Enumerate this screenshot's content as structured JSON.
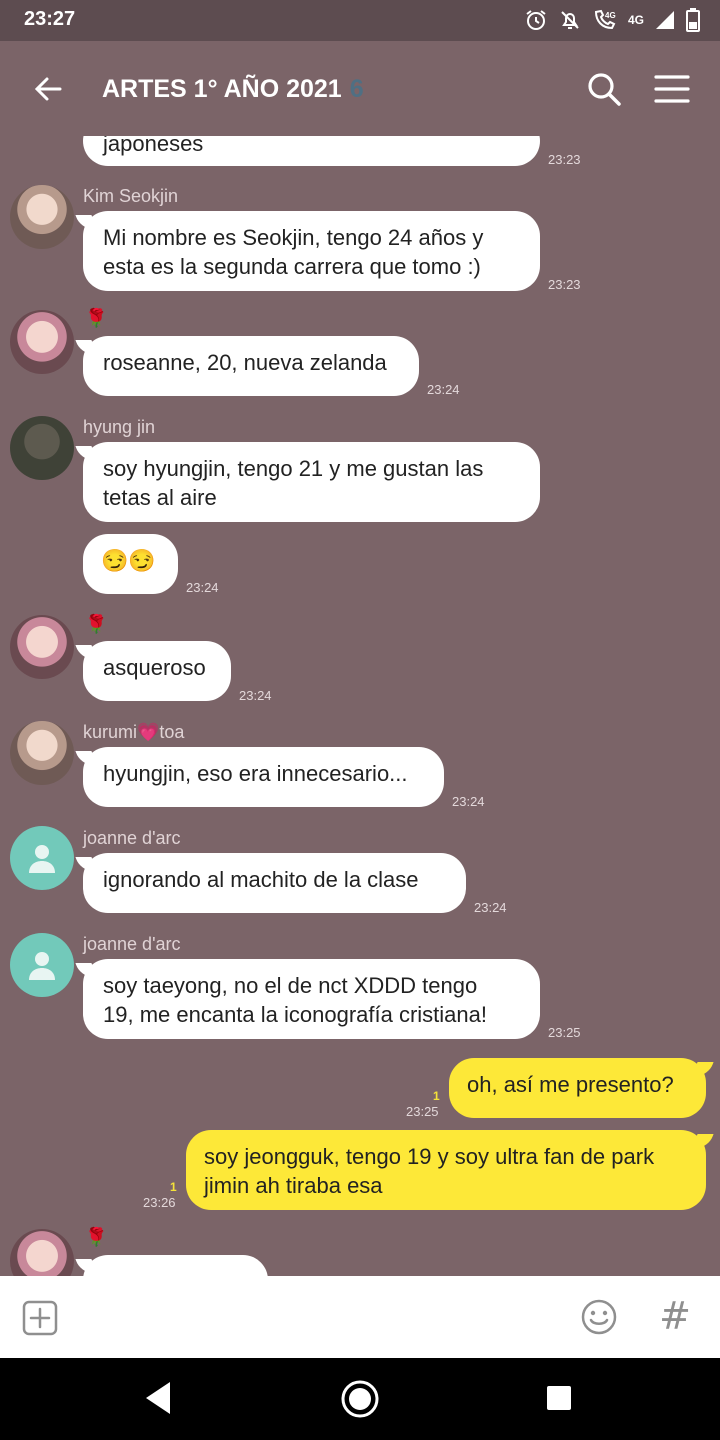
{
  "status": {
    "time": "23:27",
    "network": "4G",
    "call_label": "4G"
  },
  "header": {
    "title": "ARTES 1° AÑO 2021",
    "member_count": "6"
  },
  "messages": {
    "m0": {
      "text": "japoneses",
      "time": "23:23"
    },
    "m1": {
      "sender": "Kim Seokjin",
      "text": "Mi nombre es Seokjin, tengo 24 años y\nesta es la segunda carrera que tomo :)",
      "time": "23:23"
    },
    "m2": {
      "sender": "🌹",
      "text": "roseanne, 20, nueva zelanda",
      "time": "23:24"
    },
    "m3": {
      "sender": "hyung jin",
      "text": "soy hyungjin, tengo 21 y me gustan las\ntetas al aire"
    },
    "m4": {
      "text": "😏😏",
      "time": "23:24"
    },
    "m5": {
      "sender": "🌹",
      "text": "asqueroso",
      "time": "23:24"
    },
    "m6": {
      "sender": "kurumi💗toa",
      "text": "hyungjin, eso era innecesario...",
      "time": "23:24"
    },
    "m7": {
      "sender": "joanne d'arc",
      "text": "ignorando al machito de la clase",
      "time": "23:24"
    },
    "m8": {
      "sender": "joanne d'arc",
      "text": "soy taeyong, no el de nct XDDD tengo\n19, me encanta la iconografía cristiana!",
      "time": "23:25"
    },
    "m9": {
      "text": "oh, así me presento?",
      "time": "23:25",
      "read": "1"
    },
    "m10": {
      "text": "soy jeongguk, tengo 19 y soy ultra fan de park\njimin ah tiraba esa",
      "time": "23:26",
      "read": "1"
    },
    "m11": {
      "sender": "🌹"
    }
  },
  "colors": {
    "chat_bg": "#7b6468",
    "status_bg": "#5d4c50",
    "out_bubble": "#fde838",
    "in_bubble": "#ffffff",
    "accent_count": "#4f6f83"
  },
  "icons": {
    "back": "back-arrow-icon",
    "search": "search-icon",
    "menu": "menu-icon",
    "plus": "plus-box-icon",
    "emoji": "emoji-icon",
    "hash": "#"
  }
}
